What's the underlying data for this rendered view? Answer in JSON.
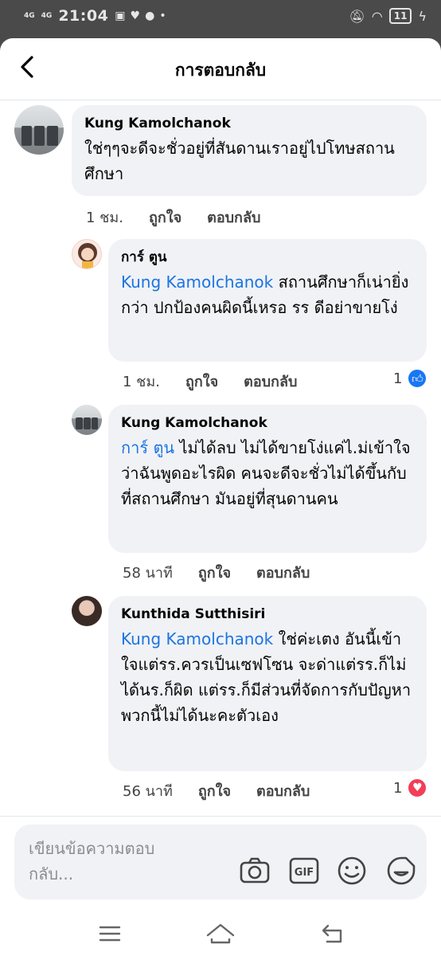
{
  "status_bar": {
    "network_1": "4G",
    "network_2": "4G",
    "time": "21:04",
    "battery": "11"
  },
  "header": {
    "title": "การตอบกลับ"
  },
  "comments": [
    {
      "author": "Kung Kamolchanok",
      "mention": "",
      "text": "ใช่ๆๆจะดีจะชั่วอยู่ที่สันดานเราอยู่ไปโทษสถานศึกษา",
      "time": "1 ชม.",
      "like_label": "ถูกใจ",
      "reply_label": "ตอบกลับ",
      "reaction_count": ""
    },
    {
      "author": "การ์ ตูน",
      "mention": "Kung Kamolchanok",
      "text": " สถานศึกษาก็เน่ายิ่งกว่า ปกป้องคนผิดนี้เหรอ รร ดีอย่าขายโง่",
      "time": "1 ชม.",
      "like_label": "ถูกใจ",
      "reply_label": "ตอบกลับ",
      "reaction_count": "1"
    },
    {
      "author": "Kung Kamolchanok",
      "mention": "การ์ ตูน",
      "text": " ไม่ได้ลบ ไม่ได้ขายโง่แค่ไ.ม่เข้าใจว่าฉันพูดอะไรผิด คนจะดีจะชั่วไม่ได้ขึ้นกับที่สถานศึกษา มันอยู่ที่สุนดานคน",
      "time": "58 นาที",
      "like_label": "ถูกใจ",
      "reply_label": "ตอบกลับ",
      "reaction_count": ""
    },
    {
      "author": "Kunthida Sutthisiri",
      "mention": "Kung Kamolchanok",
      "text": " ใช่ค่ะเตง อันนี้เข้าใจแต่รร.ควรเป็นเซฟโซน จะด่าแต่รร.ก็ไม่ได้นร.ก็ผิด แต่รร.ก็มีส่วนที่จัดการกับปัญหาพวกนี้ไม่ได้นะคะตัวเอง",
      "time": "56 นาที",
      "like_label": "ถูกใจ",
      "reply_label": "ตอบกลับ",
      "reaction_count": "1"
    }
  ],
  "composer": {
    "placeholder": "เขียนข้อความตอบกลับ..."
  },
  "tools": [
    "camera-icon",
    "gif-icon",
    "emoji-icon",
    "sticker-icon"
  ],
  "colors": {
    "accent": "#1b74e4",
    "bubble": "#f0f2f5",
    "like": "#1877f2",
    "love": "#f33e58"
  }
}
